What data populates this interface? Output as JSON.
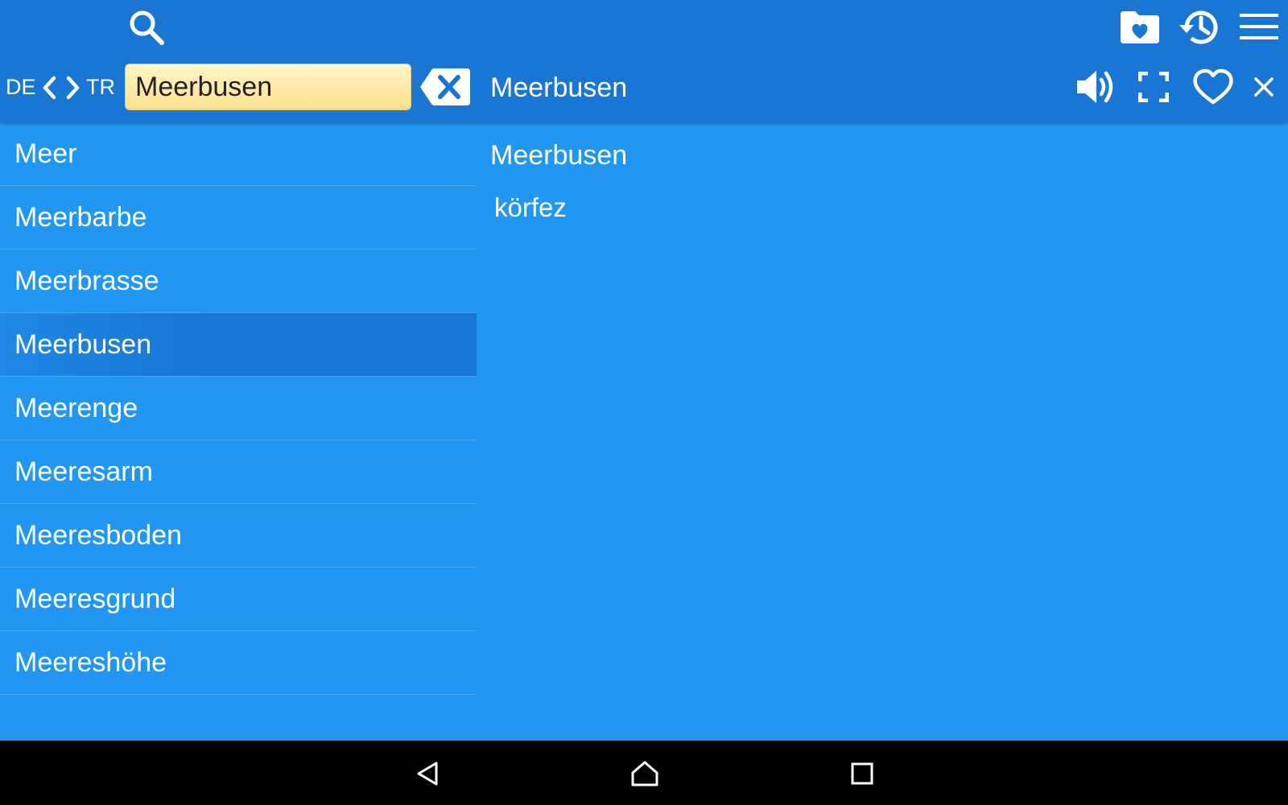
{
  "toolbar": {
    "icons": [
      "search-icon",
      "favorites-folder-icon",
      "history-icon",
      "menu-icon"
    ]
  },
  "search_row": {
    "source_lang": "DE",
    "target_lang": "TR",
    "query": "Meerbusen",
    "clear_icon": "backspace-clear-icon"
  },
  "entry_header": {
    "word": "Meerbusen",
    "icons": [
      "speaker-icon",
      "fullscreen-icon",
      "heart-outline-icon",
      "close-icon"
    ]
  },
  "word_list": {
    "selected_index": 3,
    "items": [
      "Meer",
      "Meerbarbe",
      "Meerbrasse",
      "Meerbusen",
      "Meerenge",
      "Meeresarm",
      "Meeresboden",
      "Meeresgrund",
      "Meereshöhe"
    ]
  },
  "detail": {
    "headword": "Meerbusen",
    "translation": "körfez"
  },
  "nav_bar": {
    "icons": [
      "back-icon",
      "home-icon",
      "recents-icon"
    ]
  },
  "colors": {
    "background": "#2196F3",
    "toolbar": "#1976D2",
    "selected_row": "#1976D2",
    "search_field": "#FCE08E",
    "nav_bar": "#000000"
  }
}
